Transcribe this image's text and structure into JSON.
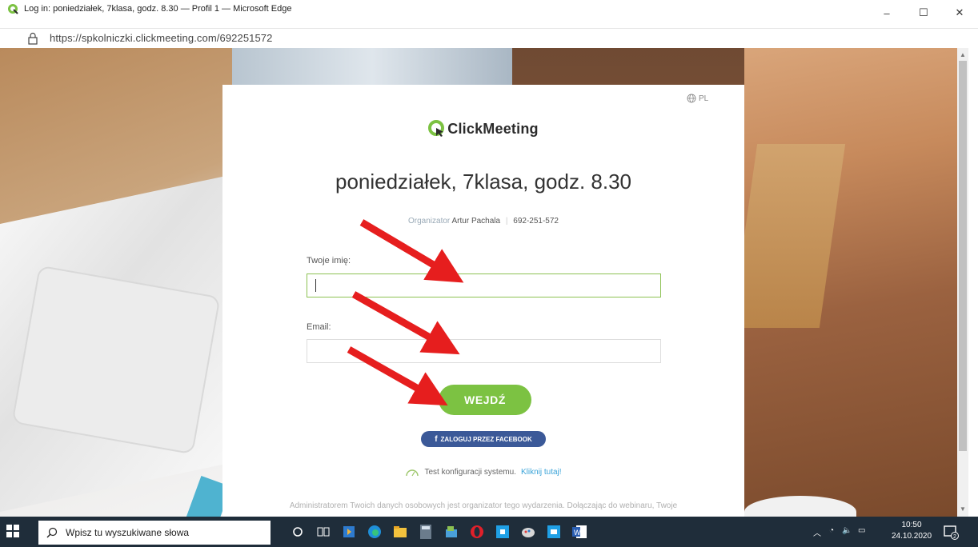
{
  "window": {
    "title": "Log in: poniedziałek, 7klasa, godz. 8.30 — Profil 1 — Microsoft Edge",
    "url": "https://spkolniczki.clickmeeting.com/692251572",
    "controls": {
      "minimize": "–",
      "maximize": "☐",
      "close": "✕"
    }
  },
  "page": {
    "language": "PL",
    "logo_text": "ClickMeeting",
    "meeting_title": "poniedziałek, 7klasa, godz. 8.30",
    "organizer_label": "Organizator",
    "organizer_name": "Artur Pachala",
    "meeting_id": "692-251-572",
    "name_label": "Twoje imię:",
    "name_value": "",
    "email_label": "Email:",
    "email_value": "",
    "enter_button": "WEJDŹ",
    "facebook_button": "ZALOGUJ PRZEZ FACEBOOK",
    "facebook_icon": "f",
    "system_test_text": "Test konfiguracji systemu.",
    "system_test_link": "Kliknij tutaj!",
    "privacy_text": "Administratorem Twoich danych osobowych jest organizator tego wydarzenia. Dołączając do webinaru, Twoje"
  },
  "taskbar": {
    "search_placeholder": "Wpisz tu wyszukiwane słowa",
    "time": "10:50",
    "date": "24.10.2020",
    "notification_count": "2"
  },
  "colors": {
    "accent_green": "#7cc242",
    "facebook_blue": "#3b5998",
    "link_blue": "#3aa3d8",
    "arrow_red": "#e61e1e",
    "taskbar": "#1f2d3a"
  }
}
